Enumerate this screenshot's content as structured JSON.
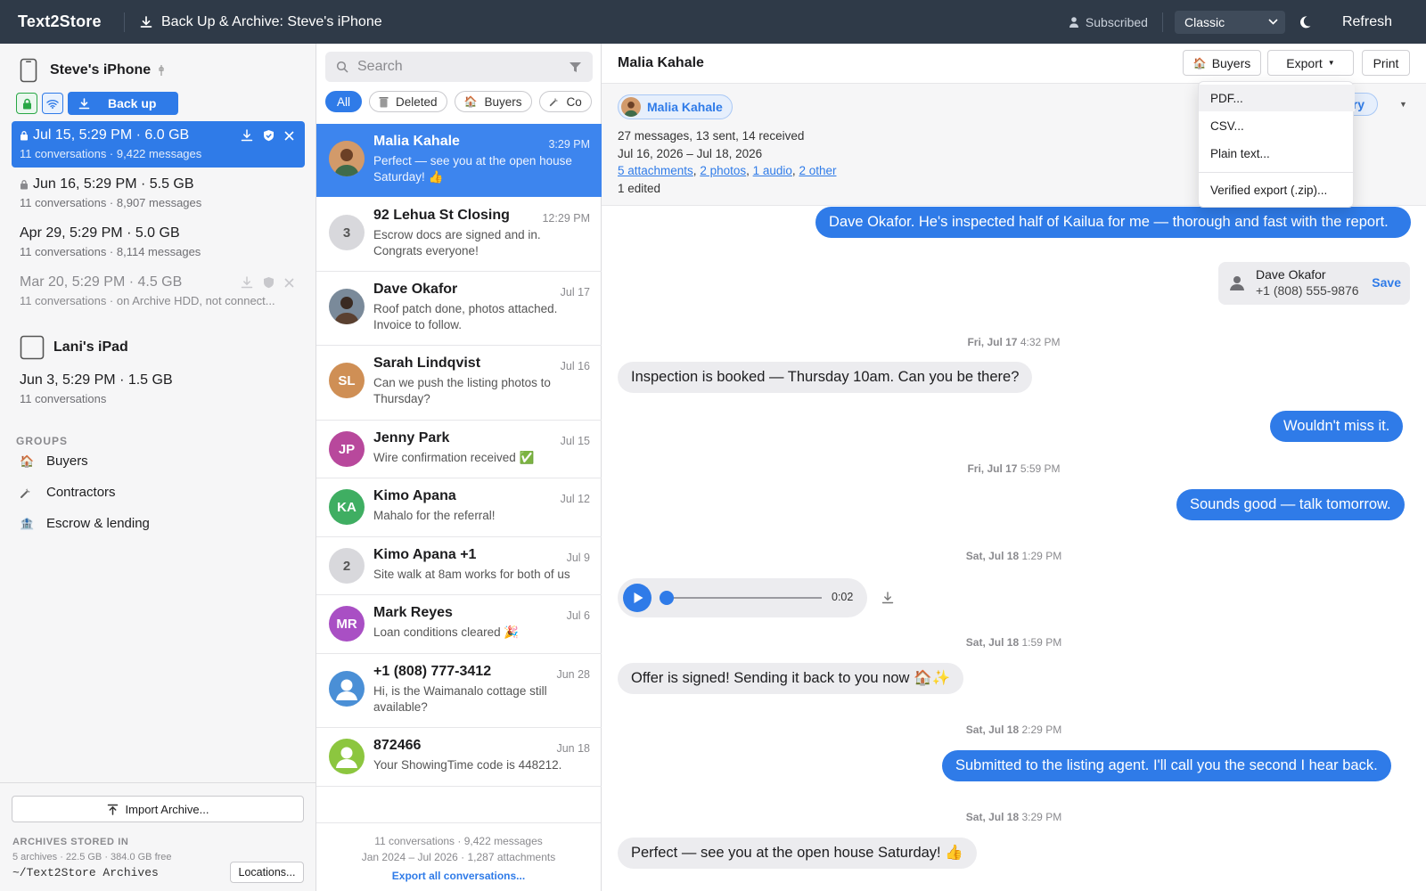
{
  "app": {
    "brand": "Text2Store",
    "window_title": "Back Up & Archive: Steve's iPhone",
    "subscription": "Subscribed",
    "theme": "Classic",
    "refresh": "Refresh"
  },
  "sidebar": {
    "devices": [
      {
        "name": "Steve's iPhone",
        "icon": "phone-icon"
      },
      {
        "name": "Lani's iPad",
        "icon": "tablet-icon"
      }
    ],
    "backup_button": "Back up",
    "snapshots": [
      {
        "title": "Jul 15, 5:29 PM · 6.0 GB",
        "detail": "11 conversations · 9,422 messages",
        "locked": true
      },
      {
        "title": "Jun 16, 5:29 PM · 5.5 GB",
        "detail": "11 conversations · 8,907 messages",
        "locked": true
      },
      {
        "title": "Apr 29, 5:29 PM · 5.0 GB",
        "detail": "11 conversations · 8,114 messages",
        "locked": false
      },
      {
        "title": "Mar 20, 5:29 PM · 4.5 GB",
        "detail": "11 conversations · on Archive HDD, not connect...",
        "locked": false
      }
    ],
    "ipad_snapshot": {
      "title": "Jun 3, 5:29 PM · 1.5 GB",
      "detail": "11 conversations"
    },
    "groups_heading": "GROUPS",
    "groups": [
      {
        "label": "Buyers",
        "icon": "house-icon"
      },
      {
        "label": "Contractors",
        "icon": "wrench-icon"
      },
      {
        "label": "Escrow & lending",
        "icon": "bank-icon"
      }
    ],
    "import_button": "Import Archive...",
    "archives_heading": "ARCHIVES STORED IN",
    "archives_stats": "5 archives · 22.5 GB · 384.0 GB free",
    "archives_path": "~/Text2Store Archives",
    "locations_button": "Locations..."
  },
  "conversation_list": {
    "search_placeholder": "Search",
    "filters": [
      {
        "label": "All",
        "icon": ""
      },
      {
        "label": "Deleted",
        "icon": "trash-icon"
      },
      {
        "label": "Buyers",
        "icon": "house-icon"
      },
      {
        "label": "Co",
        "icon": "wrench-icon"
      }
    ],
    "conversations": [
      {
        "name": "Malia Kahale",
        "time": "3:29 PM",
        "preview": "Perfect — see you at the open house Saturday! 👍",
        "avatar": "photo",
        "initials": ""
      },
      {
        "name": "92 Lehua St Closing",
        "time": "12:29 PM",
        "preview": "Escrow docs are signed and in. Congrats everyone!",
        "avatar": "count",
        "initials": "3"
      },
      {
        "name": "Dave Okafor",
        "time": "Jul 17",
        "preview": "Roof patch done, photos attached. Invoice to follow.",
        "avatar": "photo",
        "initials": ""
      },
      {
        "name": "Sarah Lindqvist",
        "time": "Jul 16",
        "preview": "Can we push the listing photos to Thursday?",
        "avatar": "initials",
        "initials": "SL"
      },
      {
        "name": "Jenny Park",
        "time": "Jul 15",
        "preview": "Wire confirmation received ✅",
        "avatar": "initials",
        "initials": "JP"
      },
      {
        "name": "Kimo Apana",
        "time": "Jul 12",
        "preview": "Mahalo for the referral!",
        "avatar": "initials",
        "initials": "KA"
      },
      {
        "name": "Kimo Apana +1",
        "time": "Jul 9",
        "preview": "Site walk at 8am works for both of us",
        "avatar": "count",
        "initials": "2"
      },
      {
        "name": "Mark Reyes",
        "time": "Jul 6",
        "preview": "Loan conditions cleared 🎉",
        "avatar": "initials",
        "initials": "MR"
      },
      {
        "name": "+1 (808) 777-3412",
        "time": "Jun 28",
        "preview": "Hi, is the Waimanalo cottage still available?",
        "avatar": "person",
        "initials": ""
      },
      {
        "name": "872466",
        "time": "Jun 18",
        "preview": "Your ShowingTime code is 448212.",
        "avatar": "person-green",
        "initials": ""
      }
    ],
    "footer_line1": "11 conversations · 9,422 messages",
    "footer_line2": "Jan 2024 – Jul 2026 · 1,287 attachments",
    "footer_link": "Export all conversations..."
  },
  "detail": {
    "contact_name": "Malia Kahale",
    "buttons": {
      "buyers": "Buyers",
      "export": "Export",
      "print": "Print"
    },
    "info": {
      "chip": "Malia Kahale",
      "counts": "27 messages, 13 sent, 14 received",
      "range": "Jul 16, 2026 – Jul 18, 2026",
      "attachments": "5 attachments",
      "photos": "2 photos",
      "audio": "1 audio",
      "other": "2 other",
      "edited": "1 edited",
      "summary_fragment": "ary"
    },
    "export_menu": [
      "PDF...",
      "CSV...",
      "Plain text...",
      "Verified export (.zip)..."
    ],
    "messages": {
      "m1": "Dave Okafor. He's inspected half of Kailua for me — thorough and fast with the report.",
      "card_name": "Dave Okafor",
      "card_phone": "+1 (808) 555-9876",
      "card_save": "Save",
      "ts1_day": "Fri, Jul 17",
      "ts1_time": "4:32 PM",
      "m2": "Inspection is booked — Thursday 10am. Can you be there?",
      "m3": "Wouldn't miss it.",
      "ts2_day": "Fri, Jul 17",
      "ts2_time": "5:59 PM",
      "m4": "Sounds good — talk tomorrow.",
      "ts3_day": "Sat, Jul 18",
      "ts3_time": "1:29 PM",
      "audio_duration": "0:02",
      "ts4_day": "Sat, Jul 18",
      "ts4_time": "1:59 PM",
      "m5": "Offer is signed! Sending it back to you now 🏠✨",
      "ts5_day": "Sat, Jul 18",
      "ts5_time": "2:29 PM",
      "m6": "Submitted to the listing agent. I'll call you the second I hear back.",
      "ts6_day": "Sat, Jul 18",
      "ts6_time": "3:29 PM",
      "m7": "Perfect — see you at the open house Saturday! 👍"
    }
  },
  "colors": {
    "accent": "#2f7be8",
    "topbar": "#2f3a48"
  }
}
